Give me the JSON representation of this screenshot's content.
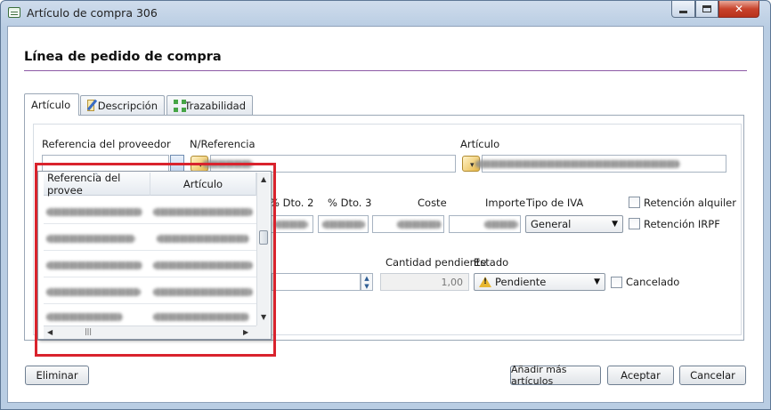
{
  "window": {
    "title": "Artículo de compra 306"
  },
  "heading": "Línea de pedido de compra",
  "tabs": [
    {
      "label": "Artículo",
      "active": true
    },
    {
      "label": "Descripción",
      "icon": "edit-document-icon"
    },
    {
      "label": "Trazabilidad",
      "icon": "arrows-expand-icon"
    }
  ],
  "fields": {
    "ref_proveedor": "Referencia del proveedor",
    "n_referencia": "N/Referencia",
    "articulo": "Artículo",
    "dto2": "% Dto. 2",
    "dto3": "% Dto. 3",
    "coste": "Coste",
    "importe": "Importe",
    "tipo_iva": "Tipo de IVA",
    "tipo_iva_value": "General",
    "retencion_alquiler": "Retención alquiler",
    "retencion_irpf": "Retención IRPF",
    "cantidad_pendiente": "Cantidad pendiente",
    "cantidad_pendiente_value": "1,00",
    "estado": "Estado",
    "estado_value": "Pendiente",
    "cancelado": "Cancelado"
  },
  "popup": {
    "columns": [
      "Referencia del proveedor",
      "Artículo"
    ],
    "column_headers_shown": [
      "Referencia del provee",
      "Artículo"
    ]
  },
  "buttons": {
    "eliminar": "Eliminar",
    "anadir": "Añadir más artículos",
    "aceptar": "Aceptar",
    "cancelar": "Cancelar"
  },
  "colors": {
    "highlight": "#d9232d",
    "heading_rule": "#8d5aa6",
    "close_button": "#c8432c"
  }
}
